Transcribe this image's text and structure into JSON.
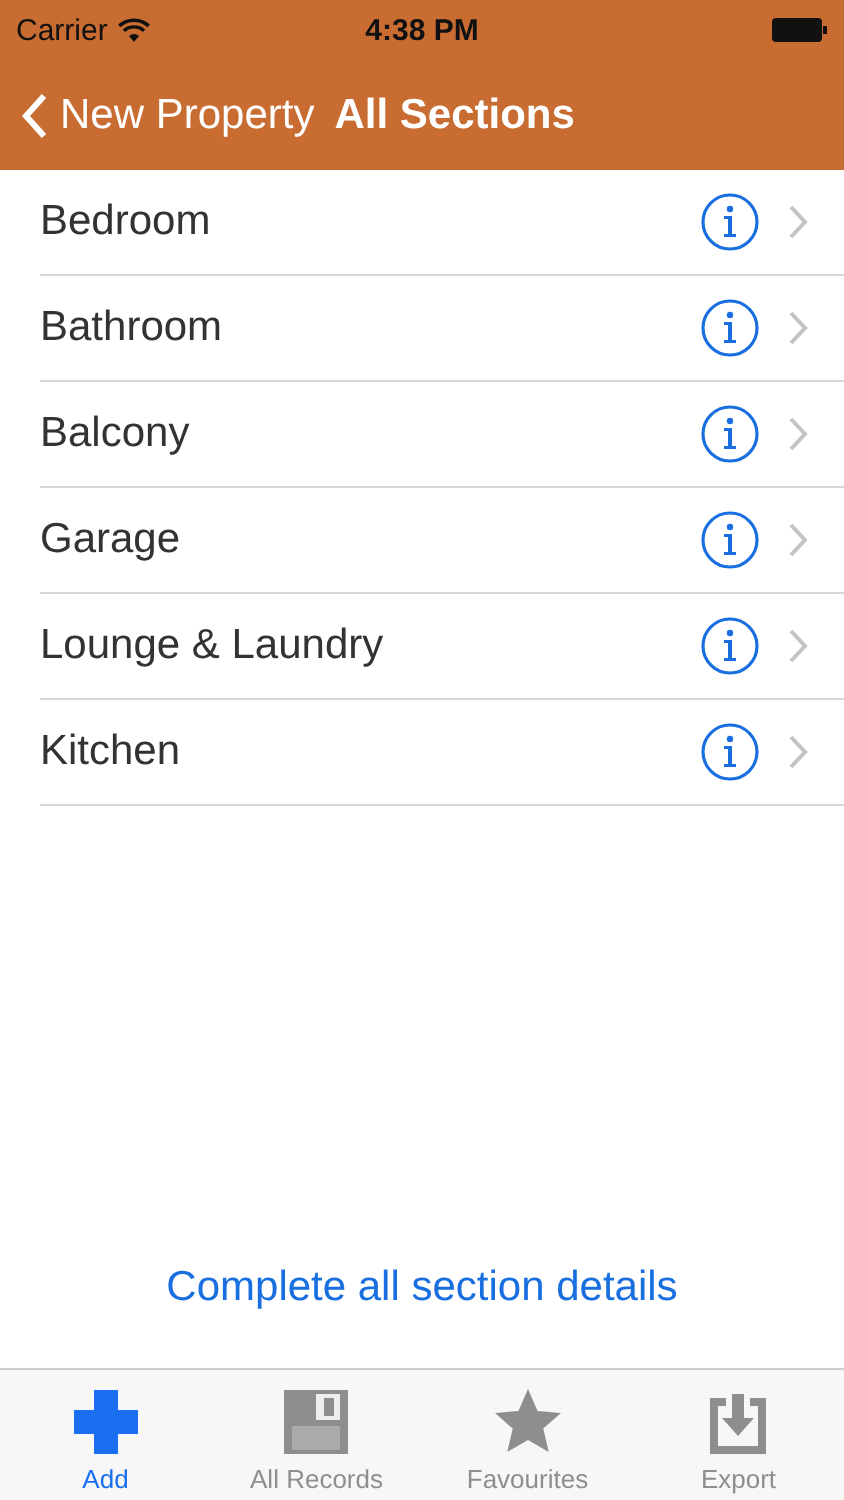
{
  "status_bar": {
    "carrier": "Carrier",
    "time": "4:38 PM"
  },
  "nav": {
    "back": "New Property",
    "title": "All Sections"
  },
  "sections": [
    {
      "label": "Bedroom"
    },
    {
      "label": "Bathroom"
    },
    {
      "label": "Balcony"
    },
    {
      "label": "Garage"
    },
    {
      "label": "Lounge & Laundry"
    },
    {
      "label": "Kitchen"
    }
  ],
  "footer_link": "Complete all section details",
  "tabs": [
    {
      "label": "Add",
      "selected": true
    },
    {
      "label": "All Records",
      "selected": false
    },
    {
      "label": "Favourites",
      "selected": false
    },
    {
      "label": "Export",
      "selected": false
    }
  ]
}
